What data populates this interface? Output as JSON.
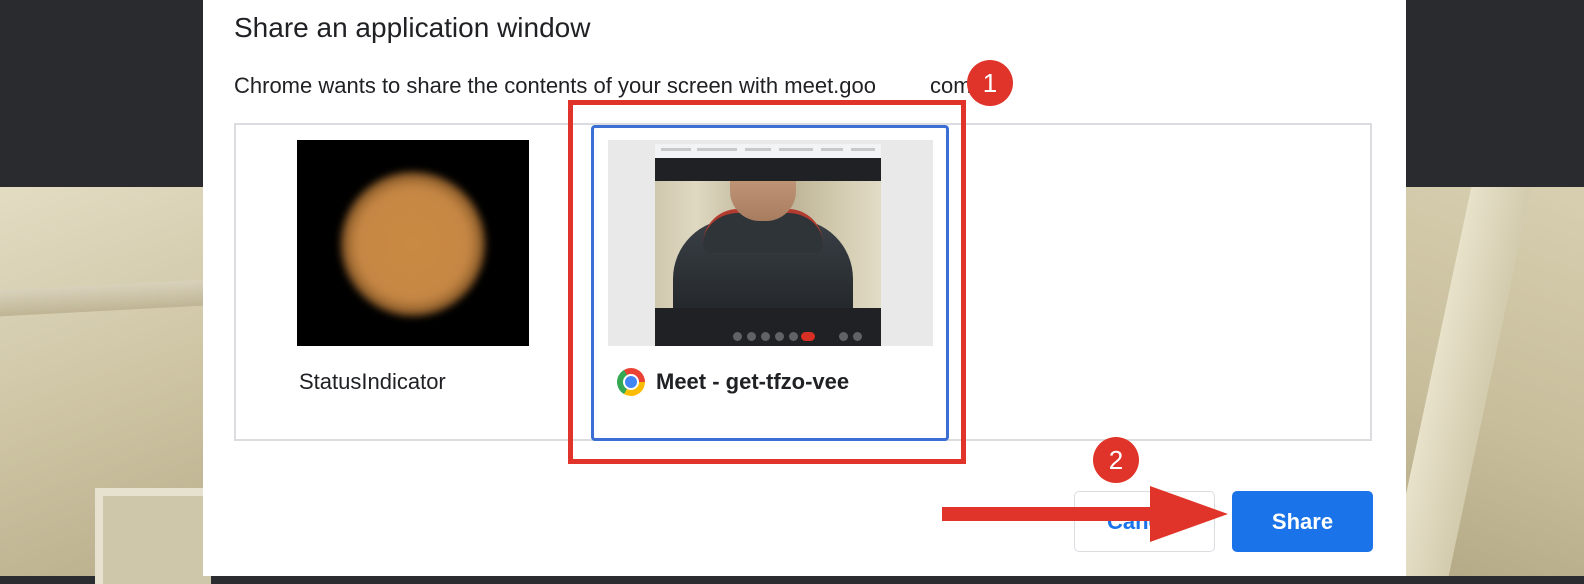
{
  "dialog": {
    "title": "Share an application window",
    "subtitle": "Chrome wants to share the contents of your screen with meet.goo",
    "subtitle_tail": "com."
  },
  "windows": [
    {
      "label": "StatusIndicator",
      "selected": false
    },
    {
      "label": "Meet - get-tfzo-vee",
      "selected": true,
      "icon": "chrome-icon"
    }
  ],
  "buttons": {
    "cancel_label": "Cancel",
    "share_label": "Share"
  },
  "annotations": {
    "step1": "1",
    "step2": "2",
    "color": "#e0342a"
  },
  "colors": {
    "accent": "#1a73e8",
    "selection_border": "#3b6fd4"
  }
}
